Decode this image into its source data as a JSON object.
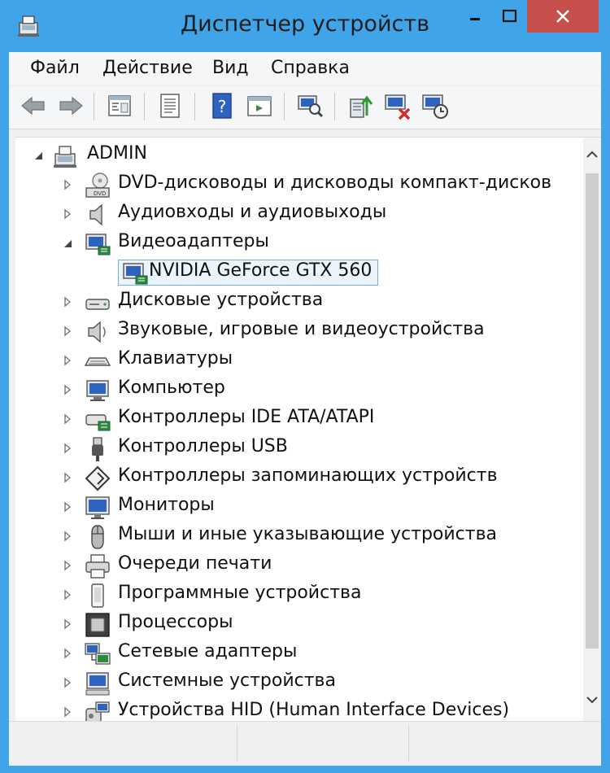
{
  "window": {
    "title": "Диспетчер устройств",
    "controls": {
      "minimize_icon": "minimize-icon",
      "maximize_icon": "maximize-icon",
      "close_icon": "close-icon"
    }
  },
  "menu": {
    "items": [
      "Файл",
      "Действие",
      "Вид",
      "Справка"
    ]
  },
  "toolbar": {
    "buttons": [
      "back-arrow-icon",
      "forward-arrow-icon",
      "console-tree-icon",
      "properties-icon",
      "help-icon",
      "action-pane-icon",
      "scan-hardware-icon",
      "update-driver-icon",
      "uninstall-device-icon",
      "disable-device-icon"
    ]
  },
  "tree": {
    "root": {
      "label": "ADMIN",
      "icon": "computer-root-icon",
      "expanded": true
    },
    "categories": [
      {
        "label": "DVD-дисководы и дисководы компакт-дисков",
        "icon": "dvd-drive-icon"
      },
      {
        "label": "Аудиовходы и аудиовыходы",
        "icon": "speaker-icon"
      },
      {
        "label": "Видеоадаптеры",
        "icon": "display-adapter-icon",
        "expanded": true,
        "children": [
          {
            "label": "NVIDIA GeForce GTX 560",
            "icon": "display-adapter-icon",
            "selected": true
          }
        ]
      },
      {
        "label": "Дисковые устройства",
        "icon": "disk-drive-icon"
      },
      {
        "label": "Звуковые, игровые и видеоустройства",
        "icon": "sound-icon"
      },
      {
        "label": "Клавиатуры",
        "icon": "keyboard-icon"
      },
      {
        "label": "Компьютер",
        "icon": "computer-icon"
      },
      {
        "label": "Контроллеры IDE ATA/ATAPI",
        "icon": "ide-controller-icon"
      },
      {
        "label": "Контроллеры USB",
        "icon": "usb-icon"
      },
      {
        "label": "Контроллеры запоминающих устройств",
        "icon": "storage-controller-icon"
      },
      {
        "label": "Мониторы",
        "icon": "monitor-icon"
      },
      {
        "label": "Мыши и иные указывающие устройства",
        "icon": "mouse-icon"
      },
      {
        "label": "Очереди печати",
        "icon": "printer-icon"
      },
      {
        "label": "Программные устройства",
        "icon": "software-device-icon"
      },
      {
        "label": "Процессоры",
        "icon": "processor-icon"
      },
      {
        "label": "Сетевые адаптеры",
        "icon": "network-adapter-icon"
      },
      {
        "label": "Системные устройства",
        "icon": "system-device-icon"
      },
      {
        "label": "Устройства HID (Human Interface Devices)",
        "icon": "hid-icon"
      }
    ]
  },
  "colors": {
    "title_bar": "#3fa5e8",
    "close_button": "#c7504c",
    "selection_fill": "#eaf4fc",
    "selection_border": "#6fb1e0"
  }
}
